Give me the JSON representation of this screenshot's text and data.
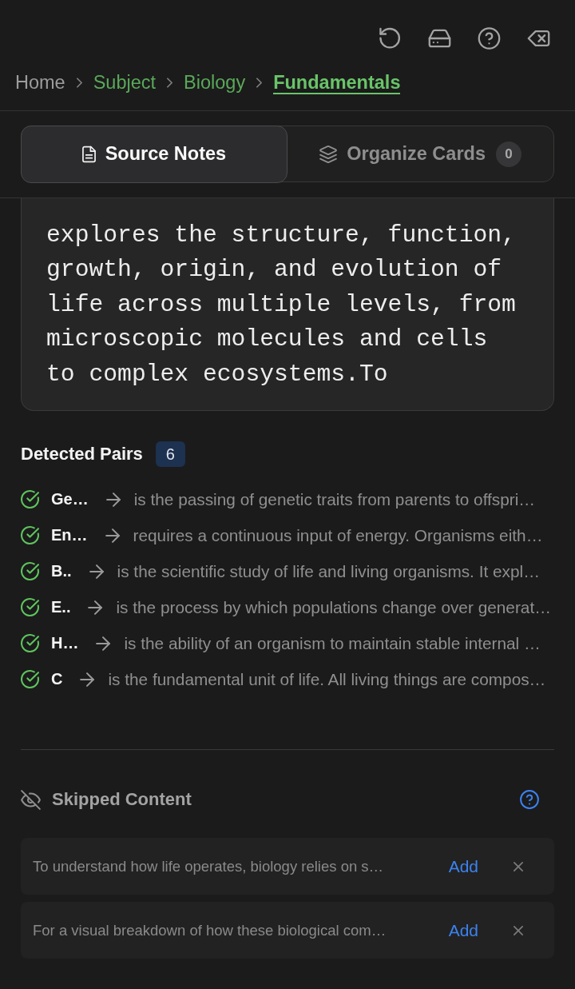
{
  "breadcrumb": [
    {
      "label": "Home",
      "kind": "root",
      "selected": false
    },
    {
      "label": "Subject",
      "kind": "link",
      "selected": false
    },
    {
      "label": "Biology",
      "kind": "link",
      "selected": false
    },
    {
      "label": "Fundamentals",
      "kind": "link",
      "selected": true
    }
  ],
  "tabs": [
    {
      "label": "Source Notes",
      "selected": true
    },
    {
      "label": "Organize Cards",
      "selected": false,
      "badge": "0"
    }
  ],
  "source_notes": {
    "text": "explores the structure, function, growth, origin, and evolution of life across multiple levels, from microscopic molecules and cells to complex ecosystems.To"
  },
  "detected_pairs": {
    "title": "Detected Pairs",
    "count": "6",
    "items": [
      {
        "term": "Ge…",
        "definition": "is the passing of genetic traits from parents to offspri…",
        "checked": true
      },
      {
        "term": "En…",
        "definition": "requires a continuous input of energy. Organisms eith…",
        "checked": true
      },
      {
        "term": "B..",
        "definition": "is the scientific study of life and living organisms. It expl…",
        "checked": true
      },
      {
        "term": "E..",
        "definition": "is the process by which populations change over generat…",
        "checked": true
      },
      {
        "term": "H…",
        "definition": "is the ability of an organism to maintain stable internal …",
        "checked": true
      },
      {
        "term": "C",
        "definition": "is the fundamental unit of life. All living things are compos…",
        "checked": true
      }
    ]
  },
  "skipped_content": {
    "title": "Skipped Content",
    "items": [
      {
        "text": "To understand how life operates, biology relies on s…",
        "action": "Add"
      },
      {
        "text": "For a visual breakdown of how these biological com…",
        "action": "Add"
      }
    ]
  }
}
